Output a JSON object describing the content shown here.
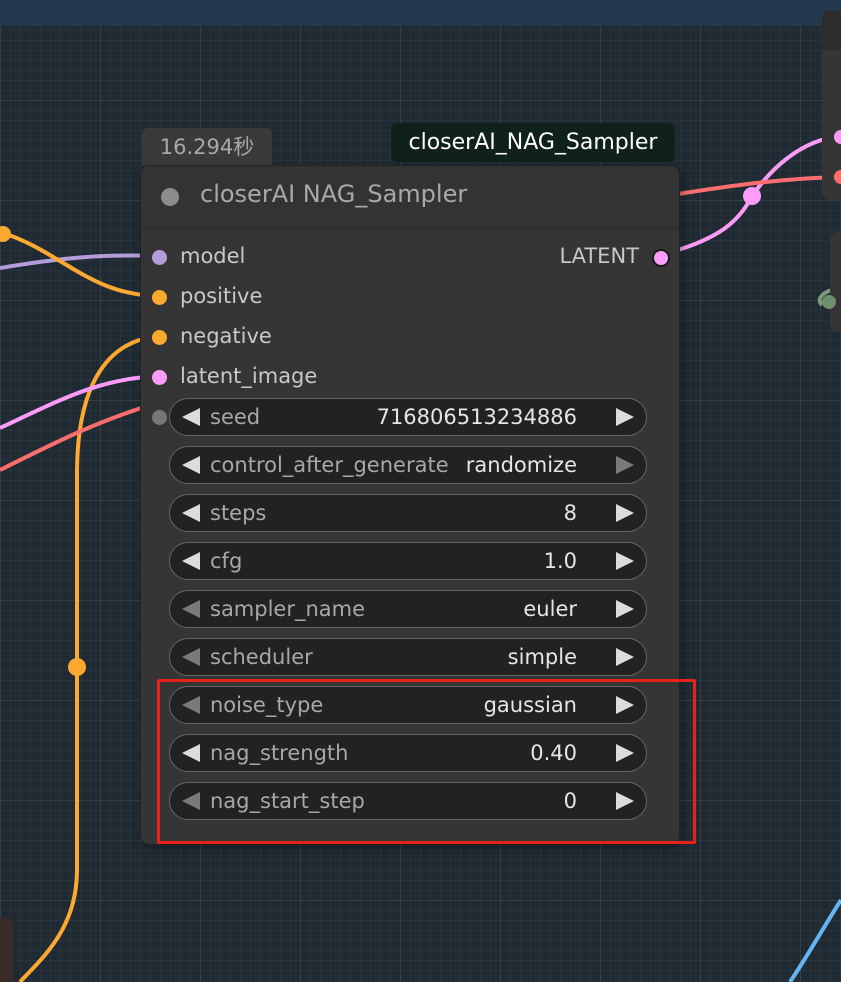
{
  "canvas": {
    "background": "#1f2a33",
    "link_colors": {
      "model": "#b39ddb",
      "conditioning": "#ffa931",
      "latent": "#ff9cf9",
      "red_link": "#ff6e6e",
      "blue_link": "#64b5f6"
    }
  },
  "timer_label": "16.294秒",
  "title_badge": "closerAI_NAG_Sampler",
  "node": {
    "title": "closerAI NAG_Sampler",
    "inputs": [
      {
        "label": "model",
        "color": "#b39ddb"
      },
      {
        "label": "positive",
        "color": "#ffa931"
      },
      {
        "label": "negative",
        "color": "#ffa931"
      },
      {
        "label": "latent_image",
        "color": "#ff9cf9"
      }
    ],
    "output": {
      "label": "LATENT",
      "color": "#ff9cf9"
    },
    "widgets": [
      {
        "name": "seed",
        "value": "716806513234886",
        "left_arrow_dim": false,
        "right_arrow_dim": false
      },
      {
        "name": "control_after_generate",
        "value": "randomize",
        "left_arrow_dim": false,
        "right_arrow_dim": true
      },
      {
        "name": "steps",
        "value": "8",
        "left_arrow_dim": false,
        "right_arrow_dim": false
      },
      {
        "name": "cfg",
        "value": "1.0",
        "left_arrow_dim": false,
        "right_arrow_dim": false
      },
      {
        "name": "sampler_name",
        "value": "euler",
        "left_arrow_dim": true,
        "right_arrow_dim": false
      },
      {
        "name": "scheduler",
        "value": "simple",
        "left_arrow_dim": true,
        "right_arrow_dim": false
      },
      {
        "name": "noise_type",
        "value": "gaussian",
        "left_arrow_dim": true,
        "right_arrow_dim": false
      },
      {
        "name": "nag_strength",
        "value": "0.40",
        "left_arrow_dim": false,
        "right_arrow_dim": false
      },
      {
        "name": "nag_start_step",
        "value": "0",
        "left_arrow_dim": true,
        "right_arrow_dim": false
      }
    ]
  },
  "highlight_color": "#e8221a"
}
